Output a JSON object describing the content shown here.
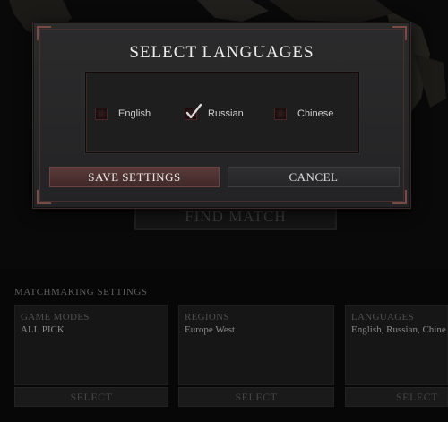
{
  "modal": {
    "title": "SELECT LANGUAGES",
    "languages": [
      {
        "label": "English",
        "checked": false
      },
      {
        "label": "Russian",
        "checked": true
      },
      {
        "label": "Chinese",
        "checked": false
      }
    ],
    "save_label": "SAVE SETTINGS",
    "cancel_label": "CANCEL"
  },
  "background": {
    "find_match_label": "FIND MATCH",
    "matchmaking_title": "MATCHMAKING SETTINGS",
    "panels": [
      {
        "label": "GAME MODES",
        "value": "ALL PICK",
        "select_label": "SELECT"
      },
      {
        "label": "REGIONS",
        "value": "Europe West",
        "select_label": "SELECT"
      },
      {
        "label": "LANGUAGES",
        "value": "English, Russian, Chine",
        "select_label": "SELECT"
      }
    ]
  },
  "colors": {
    "accent": "#5a3a38",
    "frame": "#4a2f2f",
    "modal_bg": "#2b2b2c"
  }
}
